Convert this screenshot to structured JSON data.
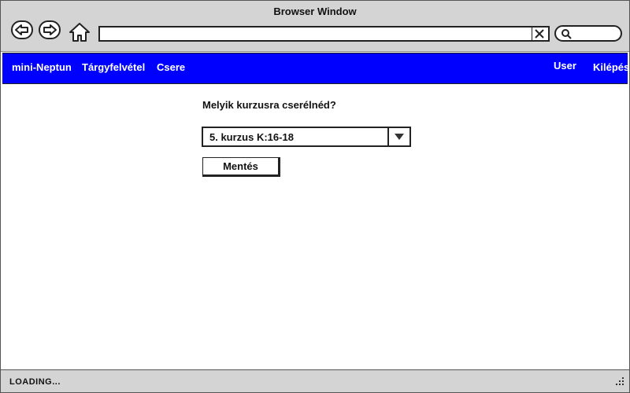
{
  "window": {
    "title": "Browser Window"
  },
  "toolbar": {
    "back_icon": "back-arrow-icon",
    "forward_icon": "forward-arrow-icon",
    "home_icon": "home-icon",
    "url_value": "",
    "clear_icon": "close-icon",
    "search_icon": "search-icon"
  },
  "navbar": {
    "background": "#0000ff",
    "items_left": [
      {
        "label": "mini-Neptun"
      },
      {
        "label": "Tárgyfelvétel"
      },
      {
        "label": "Csere"
      }
    ],
    "items_right": [
      {
        "label": "User"
      },
      {
        "label": "Kilépés"
      }
    ]
  },
  "main": {
    "question": "Melyik kurzusra cserélnéd?",
    "course_select": {
      "selected": "5. kurzus K:16-18"
    },
    "save_label": "Mentés"
  },
  "status": {
    "text": "LOADING..."
  }
}
